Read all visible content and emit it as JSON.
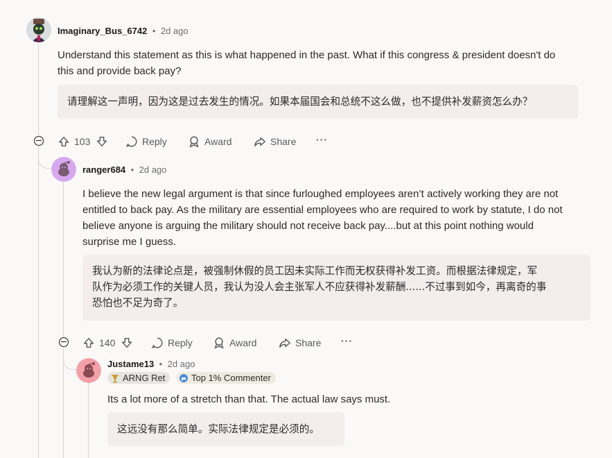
{
  "comments": [
    {
      "author": "Imaginary_Bus_6742",
      "sep": "•",
      "time": "2d ago",
      "body_line1": "Understand this statement as this is what happened in the past. What if this congress & president doesn't do",
      "body_line2": "this and provide back pay?",
      "translation": "请理解这一声明，因为这是过去发生的情况。如果本届国会和总统不这么做，也不提供补发薪资怎么办？",
      "votes": "103",
      "reply_label": "Reply",
      "award_label": "Award",
      "share_label": "Share",
      "more_label": "···"
    },
    {
      "author": "ranger684",
      "sep": "•",
      "time": "2d ago",
      "body_line1": "I believe the new legal argument is that since furloughed employees aren’t actively working they are not",
      "body_line2": "entitled to back pay. As the military are essential employees who are required to work by statute, I do not",
      "body_line3": "believe anyone is arguing the military should not receive back pay....but at this point nothing would",
      "body_line4": "surprise me I guess.",
      "translation_line1": "我认为新的法律论点是，被强制休假的员工因未实际工作而无权获得补发工资。而根据法律规定，军",
      "translation_line2": "队作为必须工作的关键人员，我认为没人会主张军人不应获得补发薪酬......不过事到如今，再离奇的事",
      "translation_line3": "恐怕也不足为奇了。",
      "votes": "140",
      "reply_label": "Reply",
      "award_label": "Award",
      "share_label": "Share",
      "more_label": "···"
    },
    {
      "author": "Justame13",
      "sep": "•",
      "time": "2d ago",
      "flair1": "ARNG Ret",
      "flair2": "Top 1% Commenter",
      "body_line1": "Its a lot more of a stretch than that. The actual law says must.",
      "translation": "这远没有那么简单。实际法律规定是必须的。"
    }
  ],
  "colors": {
    "background": "#fbf9f8",
    "translation_bg": "#f3eeec",
    "avatar2": "#d7a8f0",
    "avatar3": "#f4a0a8"
  },
  "icons": [
    "collapse-icon",
    "upvote-icon",
    "downvote-icon",
    "reply-icon",
    "award-icon",
    "share-icon",
    "more-icon",
    "trophy-icon",
    "top-commenter-icon"
  ]
}
